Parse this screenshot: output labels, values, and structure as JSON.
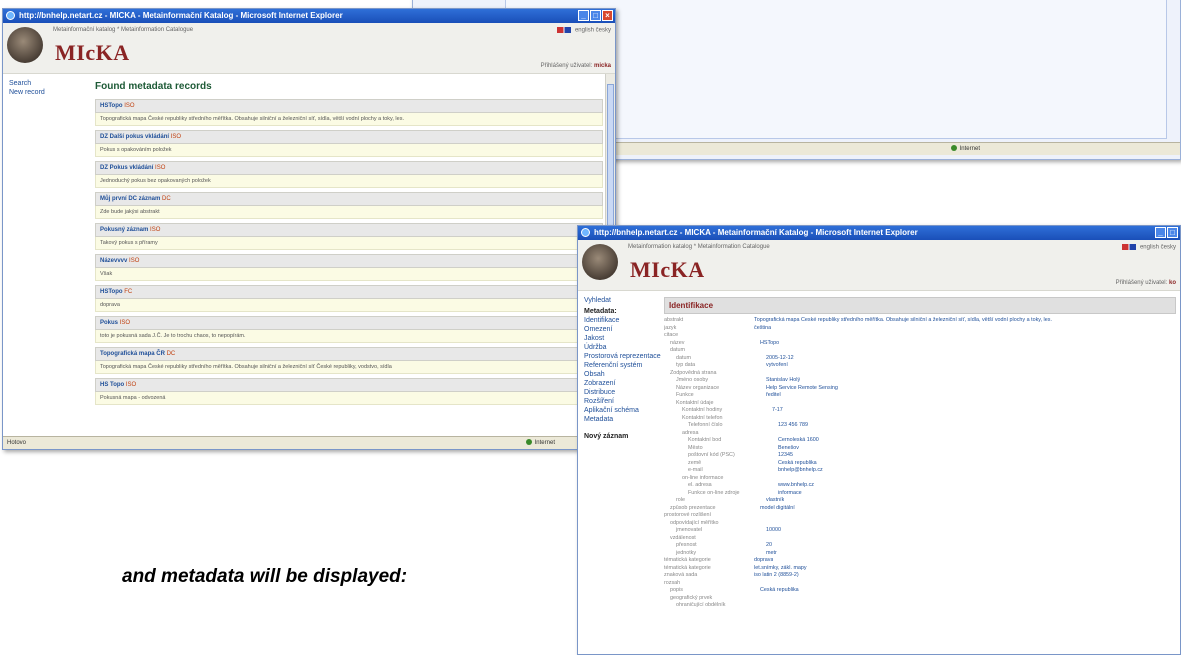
{
  "back_window": {
    "status_text": "Internet"
  },
  "left_window": {
    "title": "http://bnhelp.netart.cz - MICKA - Metainformační Katalog - Microsoft Internet Explorer",
    "subtitle": "Metainformační katalog * Metainformation Catalogue",
    "brand": "MIcKA",
    "lang_links": "english česky",
    "user_label": "Přihlášený uživatel:",
    "user_name": "micka",
    "sidebar": [
      "Search",
      "New record"
    ],
    "heading": "Found metadata records",
    "records": [
      {
        "title": "HSTopo",
        "std": "ISO",
        "desc": "Topografická mapa České republiky středního měřítka. Obsahuje silniční a železniční síť, sídla, větší vodní plochy a toky, les."
      },
      {
        "title": "DZ Další pokus vkládání",
        "std": "ISO",
        "desc": "Pokus s opakováním položek"
      },
      {
        "title": "DZ Pokus vkládání",
        "std": "ISO",
        "desc": "Jednoduchý pokus bez opakovaných položek"
      },
      {
        "title": "Můj první DC záznam",
        "std": "DC",
        "desc": "Zde bude jakýsi abstrakt"
      },
      {
        "title": "Pokusný záznam",
        "std": "ISO",
        "desc": "Takový pokus s příramy"
      },
      {
        "title": "Názevvvv",
        "std": "ISO",
        "desc": "Však"
      },
      {
        "title": "HSTopo",
        "std": "FC",
        "desc": "doprava"
      },
      {
        "title": "Pokus",
        "std": "ISO",
        "desc": "toto je pokusná sada J.Č. Je to trochu chaos, to nepopírám."
      },
      {
        "title": "Topografická mapa ČR",
        "std": "DC",
        "desc": "Topografická mapa České republiky středního měřítka. Obsahuje silniční a železniční síť České republiky, vodstvo, sídla"
      },
      {
        "title": "HS Topo",
        "std": "ISO",
        "desc": "Pokusná mapa - odvozená"
      }
    ],
    "status_left": "Hotovo",
    "status_right": "Internet"
  },
  "right_window": {
    "title": "http://bnhelp.netart.cz - MICKA - Metainformační Katalog - Microsoft Internet Explorer",
    "subtitle": "Metainformation katalog * Metainformation Catalogue",
    "brand": "MIcKA",
    "lang_links": "english česky",
    "user_label": "Přihlášený uživatel:",
    "user_name": "ko",
    "sidebar_top": "Vyhledat",
    "sidebar_heading": "Metadata:",
    "sidebar_items": [
      "Identifikace",
      "Omezení",
      "Jakost",
      "Údržba",
      "Prostorová reprezentace",
      "Referenční systém",
      "Obsah",
      "Zobrazení",
      "Distribuce",
      "Rozšíření",
      "Aplikační schéma",
      "Metadata"
    ],
    "sidebar_new": "Nový záznam",
    "section_title": "Identifikace",
    "fields": [
      {
        "k": "abstrakt",
        "v": "Topografická mapa České republiky středního měřítka. Obsahuje silniční a železniční síť, sídla, větší vodní plochy a toky, les."
      },
      {
        "k": "jazyk",
        "v": "čeština"
      },
      {
        "k": "citace",
        "v": ""
      },
      {
        "k": "  název",
        "v": "HSTopo"
      },
      {
        "k": "  datum",
        "v": ""
      },
      {
        "k": "    datum",
        "v": "2005-12-12"
      },
      {
        "k": "    typ data",
        "v": "vytvoření"
      },
      {
        "k": "  Zodpovědná strana",
        "v": ""
      },
      {
        "k": "    Jméno osoby",
        "v": "Stanislav Holý"
      },
      {
        "k": "    Název organizace",
        "v": "Help Service Remote Sensing"
      },
      {
        "k": "    Funkce",
        "v": "ředitel"
      },
      {
        "k": "    Kontaktní údaje",
        "v": ""
      },
      {
        "k": "      Kontaktní hodiny",
        "v": "7-17"
      },
      {
        "k": "      Kontaktní telefon",
        "v": ""
      },
      {
        "k": "        Telefonní číslo",
        "v": "123 456 789"
      },
      {
        "k": "      adresa",
        "v": ""
      },
      {
        "k": "        Kontaktní bod",
        "v": "Černoleská 1600"
      },
      {
        "k": "        Město",
        "v": "Benešov"
      },
      {
        "k": "        poštovní kód (PSČ)",
        "v": "12345"
      },
      {
        "k": "        země",
        "v": "Česká republika"
      },
      {
        "k": "        e-mail",
        "v": "bnhelp@bnhelp.cz"
      },
      {
        "k": "      on-line informace",
        "v": ""
      },
      {
        "k": "        el. adresa",
        "v": "www.bnhelp.cz"
      },
      {
        "k": "        Funkce on-line zdroje",
        "v": "informace"
      },
      {
        "k": "    role",
        "v": "vlastník"
      },
      {
        "k": "  způsob prezentace",
        "v": "model digitální"
      },
      {
        "k": "prostorové rozlišení",
        "v": ""
      },
      {
        "k": "  odpovídající měřítko",
        "v": ""
      },
      {
        "k": "    jmenovatel",
        "v": "10000"
      },
      {
        "k": "  vzdálenost",
        "v": ""
      },
      {
        "k": "    přesnost",
        "v": "20"
      },
      {
        "k": "    jednotky",
        "v": "metr"
      },
      {
        "k": "tématická kategorie",
        "v": "doprava"
      },
      {
        "k": "tématická kategorie",
        "v": "let.snímky, zákl. mapy"
      },
      {
        "k": "znaková sada",
        "v": "iso latin 2 (8859-2)"
      },
      {
        "k": "rozsah",
        "v": ""
      },
      {
        "k": "  popis",
        "v": "Česká republika"
      },
      {
        "k": "  geografický prvek",
        "v": ""
      },
      {
        "k": "    ohraničující obdélník",
        "v": ""
      }
    ]
  },
  "caption": "and metadata will be displayed:"
}
